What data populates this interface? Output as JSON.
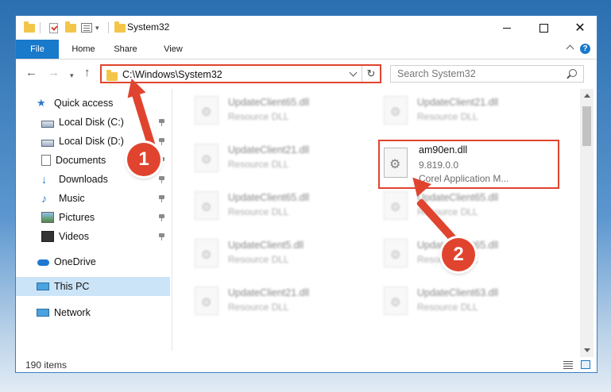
{
  "window": {
    "title": "System32"
  },
  "ribbon": {
    "tabs": [
      "File",
      "Home",
      "Share",
      "View"
    ]
  },
  "address": {
    "path": "C:\\Windows\\System32",
    "search_placeholder": "Search System32"
  },
  "sidebar": {
    "items": [
      {
        "label": "Quick access",
        "icon": "star-icon"
      },
      {
        "label": "Local Disk (C:)",
        "icon": "drive-icon",
        "pinned": true
      },
      {
        "label": "Local Disk (D:)",
        "icon": "drive-icon",
        "pinned": true
      },
      {
        "label": "Documents",
        "icon": "documents-icon",
        "pinned": true
      },
      {
        "label": "Downloads",
        "icon": "download-icon",
        "pinned": true
      },
      {
        "label": "Music",
        "icon": "music-icon",
        "pinned": true
      },
      {
        "label": "Pictures",
        "icon": "pictures-icon",
        "pinned": true
      },
      {
        "label": "Videos",
        "icon": "videos-icon",
        "pinned": true
      },
      {
        "label": "OneDrive",
        "icon": "onedrive-icon"
      },
      {
        "label": "This PC",
        "icon": "computer-icon",
        "selected": true
      },
      {
        "label": "Network",
        "icon": "network-icon"
      }
    ]
  },
  "files": {
    "left_column": [
      {
        "name": "UpdateClient65.dll",
        "type": "Resource DLL"
      },
      {
        "name": "UpdateClient21.dll",
        "type": "Resource DLL"
      },
      {
        "name": "UpdateClient65.dll",
        "type": "Resource DLL"
      },
      {
        "name": "UpdateClient5.dll",
        "type": "Resource DLL"
      },
      {
        "name": "UpdateClient21.dll",
        "type": "Resource DLL"
      }
    ],
    "right_column": [
      {
        "name": "UpdateClient21.dll",
        "type": "Resource DLL"
      },
      {
        "name": "UpdateClient65.dll",
        "type": "Resource DLL"
      },
      {
        "name": "UpdateClient65.dll",
        "type": "Resource DLL"
      },
      {
        "name": "UpdateClient63.dll",
        "type": "Resource DLL"
      }
    ],
    "highlighted": {
      "name": "am90en.dll",
      "version": "9.819.0.0",
      "description": "Corel Application M..."
    }
  },
  "status": {
    "item_count": "190 items"
  },
  "annotations": {
    "step1": "1",
    "step2": "2"
  },
  "colors": {
    "accent": "#1979ca",
    "highlight": "#e0442f",
    "selected": "#cce4f7"
  }
}
